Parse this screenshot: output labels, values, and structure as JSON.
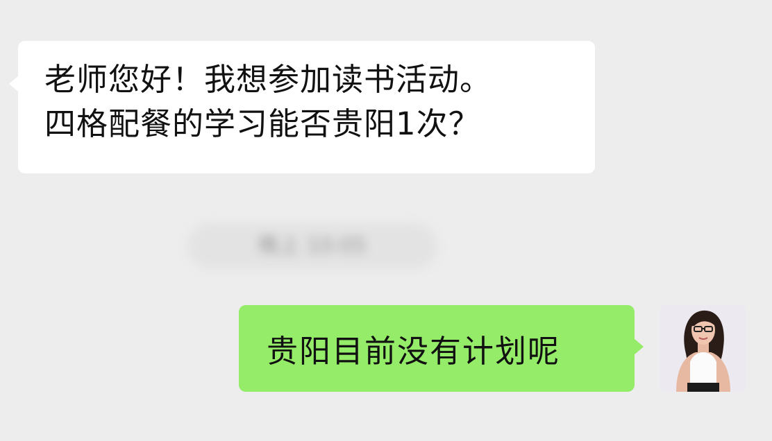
{
  "chat": {
    "incoming_message": {
      "text": "老师您好！我想参加读书活动。\n四格配餐的学习能否贵阳1次？"
    },
    "system_notice": {
      "text": "晚上 10:05"
    },
    "outgoing_message": {
      "text": "贵阳目前没有计划呢"
    },
    "avatar": {
      "icon": "user-avatar-photo"
    }
  },
  "colors": {
    "background": "#ededed",
    "incoming_bubble": "#ffffff",
    "outgoing_bubble": "#95ec69",
    "text": "#111111"
  }
}
